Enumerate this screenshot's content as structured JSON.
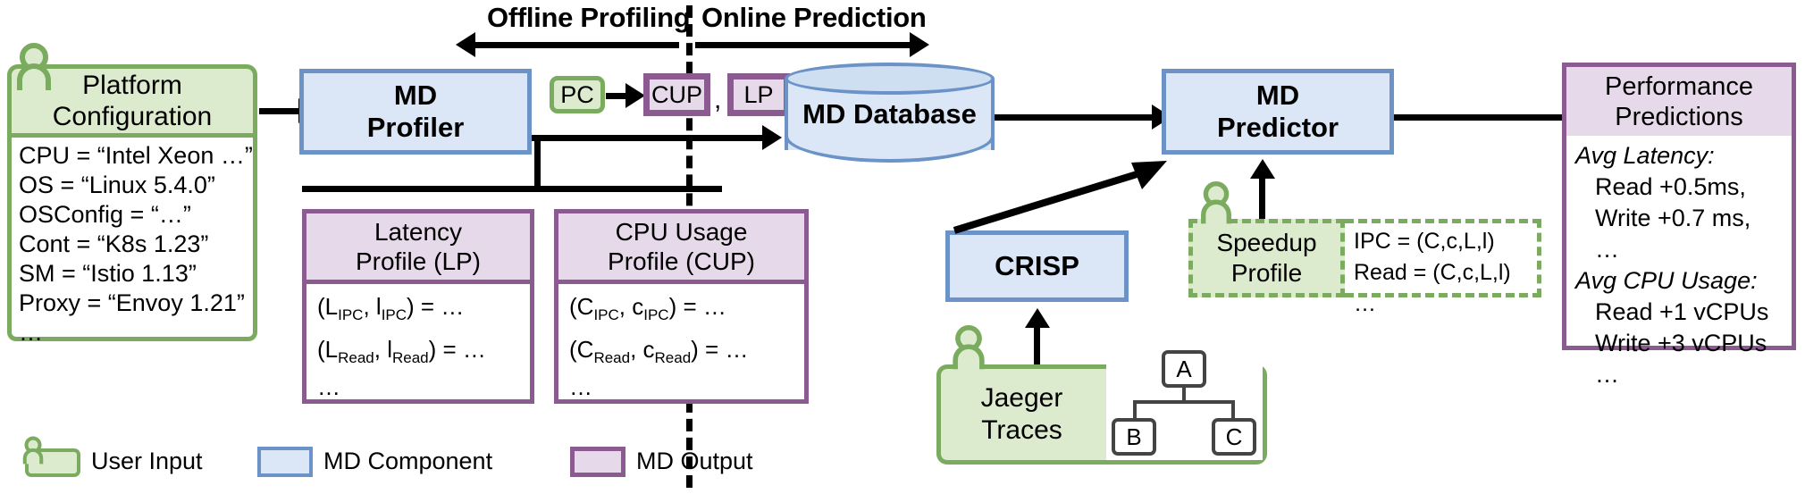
{
  "phases": {
    "offline": "Offline Profiling",
    "online": "Online Prediction"
  },
  "platform_config": {
    "title_line1": "Platform",
    "title_line2": "Configuration",
    "entries": [
      "CPU = “Intel Xeon …”",
      "OS = “Linux 5.4.0”",
      "OSConfig = “…”",
      "Cont = “K8s 1.23”",
      "SM = “Istio 1.13”",
      "Proxy = “Envoy 1.21”",
      "…"
    ]
  },
  "md_profiler": {
    "line1": "MD",
    "line2": "Profiler"
  },
  "badges": {
    "pc": "PC",
    "cup": "CUP",
    "comma": ",",
    "lp": "LP"
  },
  "md_database": {
    "label": "MD Database"
  },
  "md_predictor": {
    "line1": "MD",
    "line2": "Predictor"
  },
  "performance_predictions": {
    "title_line1": "Performance",
    "title_line2": "Predictions",
    "lines": [
      {
        "text": "Avg Latency:",
        "style": "italic"
      },
      {
        "text": "Read +0.5ms,",
        "style": "indent"
      },
      {
        "text": "Write +0.7 ms,",
        "style": "indent"
      },
      {
        "text": "…",
        "style": "indent"
      },
      {
        "text": "Avg CPU Usage:",
        "style": "italic"
      },
      {
        "text": "Read +1 vCPUs",
        "style": "indent"
      },
      {
        "text": "Write +3 vCPUs",
        "style": "indent"
      },
      {
        "text": "…",
        "style": "indent"
      }
    ]
  },
  "latency_profile": {
    "title_line1": "Latency",
    "title_line2": "Profile (LP)",
    "formulas": [
      {
        "pre": "(L",
        "sub1": "IPC",
        "mid": ", l",
        "sub2": "IPC",
        "post": ") = …"
      },
      {
        "pre": "(L",
        "sub1": "Read",
        "mid": ", l",
        "sub2": "Read",
        "post": ") = …"
      }
    ],
    "ellipsis": "…"
  },
  "cpu_usage_profile": {
    "title_line1": "CPU Usage",
    "title_line2": "Profile (CUP)",
    "formulas": [
      {
        "pre": "(C",
        "sub1": "IPC",
        "mid": ", c",
        "sub2": "IPC",
        "post": ") = …"
      },
      {
        "pre": "(C",
        "sub1": "Read",
        "mid": ", c",
        "sub2": "Read",
        "post": ") = …"
      }
    ],
    "ellipsis": "…"
  },
  "crisp": {
    "label": "CRISP"
  },
  "jaeger": {
    "line1": "Jaeger",
    "line2": "Traces",
    "tree": {
      "root": "A",
      "left": "B",
      "right": "C"
    }
  },
  "speedup_profile": {
    "line1": "Speedup",
    "line2": "Profile",
    "details": [
      "IPC = (C,c,L,l)",
      "Read = (C,c,L,l)",
      "…"
    ]
  },
  "legend": [
    {
      "label": "User Input",
      "kind": "green"
    },
    {
      "label": "MD Component",
      "kind": "blue"
    },
    {
      "label": "MD Output",
      "kind": "purple"
    }
  ],
  "colors": {
    "green_border": "#7aab5e",
    "green_fill": "#dceacd",
    "blue_border": "#6b93c7",
    "blue_fill": "#dbe6f6",
    "purple_border": "#8a5a91",
    "purple_fill": "#e6d9ea",
    "arrow": "#000000"
  }
}
